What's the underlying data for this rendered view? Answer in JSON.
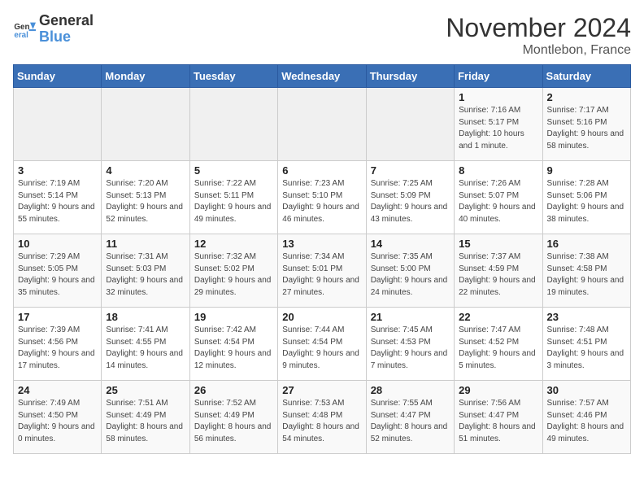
{
  "logo": {
    "line1": "General",
    "line2": "Blue"
  },
  "header": {
    "month": "November 2024",
    "location": "Montlebon, France"
  },
  "weekdays": [
    "Sunday",
    "Monday",
    "Tuesday",
    "Wednesday",
    "Thursday",
    "Friday",
    "Saturday"
  ],
  "weeks": [
    [
      {
        "day": "",
        "info": ""
      },
      {
        "day": "",
        "info": ""
      },
      {
        "day": "",
        "info": ""
      },
      {
        "day": "",
        "info": ""
      },
      {
        "day": "",
        "info": ""
      },
      {
        "day": "1",
        "info": "Sunrise: 7:16 AM\nSunset: 5:17 PM\nDaylight: 10 hours and 1 minute."
      },
      {
        "day": "2",
        "info": "Sunrise: 7:17 AM\nSunset: 5:16 PM\nDaylight: 9 hours and 58 minutes."
      }
    ],
    [
      {
        "day": "3",
        "info": "Sunrise: 7:19 AM\nSunset: 5:14 PM\nDaylight: 9 hours and 55 minutes."
      },
      {
        "day": "4",
        "info": "Sunrise: 7:20 AM\nSunset: 5:13 PM\nDaylight: 9 hours and 52 minutes."
      },
      {
        "day": "5",
        "info": "Sunrise: 7:22 AM\nSunset: 5:11 PM\nDaylight: 9 hours and 49 minutes."
      },
      {
        "day": "6",
        "info": "Sunrise: 7:23 AM\nSunset: 5:10 PM\nDaylight: 9 hours and 46 minutes."
      },
      {
        "day": "7",
        "info": "Sunrise: 7:25 AM\nSunset: 5:09 PM\nDaylight: 9 hours and 43 minutes."
      },
      {
        "day": "8",
        "info": "Sunrise: 7:26 AM\nSunset: 5:07 PM\nDaylight: 9 hours and 40 minutes."
      },
      {
        "day": "9",
        "info": "Sunrise: 7:28 AM\nSunset: 5:06 PM\nDaylight: 9 hours and 38 minutes."
      }
    ],
    [
      {
        "day": "10",
        "info": "Sunrise: 7:29 AM\nSunset: 5:05 PM\nDaylight: 9 hours and 35 minutes."
      },
      {
        "day": "11",
        "info": "Sunrise: 7:31 AM\nSunset: 5:03 PM\nDaylight: 9 hours and 32 minutes."
      },
      {
        "day": "12",
        "info": "Sunrise: 7:32 AM\nSunset: 5:02 PM\nDaylight: 9 hours and 29 minutes."
      },
      {
        "day": "13",
        "info": "Sunrise: 7:34 AM\nSunset: 5:01 PM\nDaylight: 9 hours and 27 minutes."
      },
      {
        "day": "14",
        "info": "Sunrise: 7:35 AM\nSunset: 5:00 PM\nDaylight: 9 hours and 24 minutes."
      },
      {
        "day": "15",
        "info": "Sunrise: 7:37 AM\nSunset: 4:59 PM\nDaylight: 9 hours and 22 minutes."
      },
      {
        "day": "16",
        "info": "Sunrise: 7:38 AM\nSunset: 4:58 PM\nDaylight: 9 hours and 19 minutes."
      }
    ],
    [
      {
        "day": "17",
        "info": "Sunrise: 7:39 AM\nSunset: 4:56 PM\nDaylight: 9 hours and 17 minutes."
      },
      {
        "day": "18",
        "info": "Sunrise: 7:41 AM\nSunset: 4:55 PM\nDaylight: 9 hours and 14 minutes."
      },
      {
        "day": "19",
        "info": "Sunrise: 7:42 AM\nSunset: 4:54 PM\nDaylight: 9 hours and 12 minutes."
      },
      {
        "day": "20",
        "info": "Sunrise: 7:44 AM\nSunset: 4:54 PM\nDaylight: 9 hours and 9 minutes."
      },
      {
        "day": "21",
        "info": "Sunrise: 7:45 AM\nSunset: 4:53 PM\nDaylight: 9 hours and 7 minutes."
      },
      {
        "day": "22",
        "info": "Sunrise: 7:47 AM\nSunset: 4:52 PM\nDaylight: 9 hours and 5 minutes."
      },
      {
        "day": "23",
        "info": "Sunrise: 7:48 AM\nSunset: 4:51 PM\nDaylight: 9 hours and 3 minutes."
      }
    ],
    [
      {
        "day": "24",
        "info": "Sunrise: 7:49 AM\nSunset: 4:50 PM\nDaylight: 9 hours and 0 minutes."
      },
      {
        "day": "25",
        "info": "Sunrise: 7:51 AM\nSunset: 4:49 PM\nDaylight: 8 hours and 58 minutes."
      },
      {
        "day": "26",
        "info": "Sunrise: 7:52 AM\nSunset: 4:49 PM\nDaylight: 8 hours and 56 minutes."
      },
      {
        "day": "27",
        "info": "Sunrise: 7:53 AM\nSunset: 4:48 PM\nDaylight: 8 hours and 54 minutes."
      },
      {
        "day": "28",
        "info": "Sunrise: 7:55 AM\nSunset: 4:47 PM\nDaylight: 8 hours and 52 minutes."
      },
      {
        "day": "29",
        "info": "Sunrise: 7:56 AM\nSunset: 4:47 PM\nDaylight: 8 hours and 51 minutes."
      },
      {
        "day": "30",
        "info": "Sunrise: 7:57 AM\nSunset: 4:46 PM\nDaylight: 8 hours and 49 minutes."
      }
    ]
  ]
}
